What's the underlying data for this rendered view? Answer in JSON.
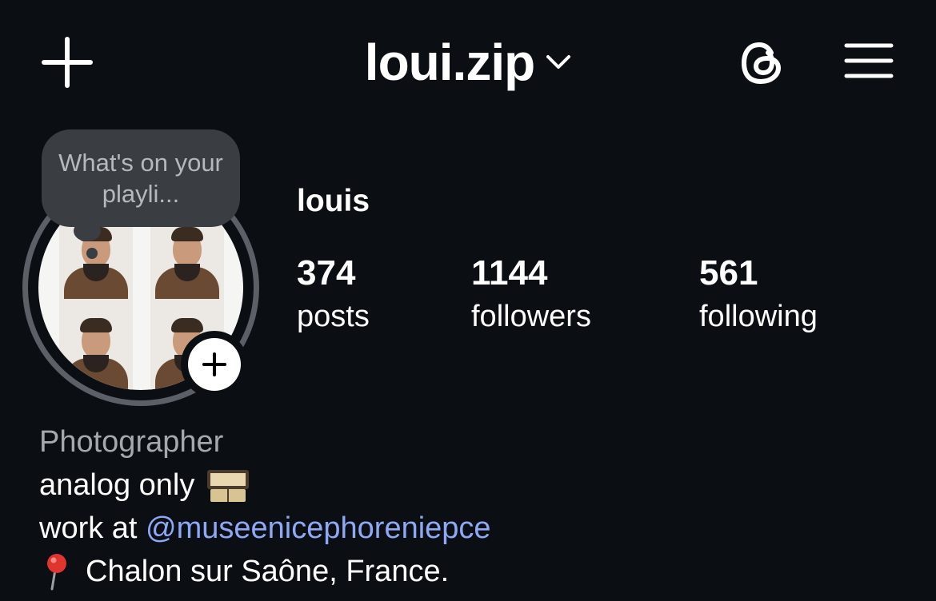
{
  "header": {
    "username": "loui.zip",
    "icons": {
      "create": "plus-icon",
      "switch_account": "chevron-down-icon",
      "threads": "threads-icon",
      "menu": "hamburger-menu-icon"
    }
  },
  "profile": {
    "display_name": "louis",
    "note": "What's on your playli...",
    "add_story_icon": "plus-icon"
  },
  "stats": [
    {
      "value": "374",
      "label": "posts"
    },
    {
      "value": "1144",
      "label": "followers"
    },
    {
      "value": "561",
      "label": "following"
    }
  ],
  "bio": {
    "category": "Photographer",
    "line1_text": "analog only",
    "line1_icon": "film-reel-icon",
    "line2_prefix": "work at",
    "line2_mention": "@museenicephoreniepce",
    "line3_icon": "location-pin-icon",
    "line3_text": "Chalon sur Saône, France."
  },
  "colors": {
    "background": "#0b0f14",
    "text": "#ffffff",
    "muted_text": "#a5a8ad",
    "link": "#8ea8f5",
    "note_bubble": "#3a3d42",
    "story_ring": "#5c6066"
  }
}
